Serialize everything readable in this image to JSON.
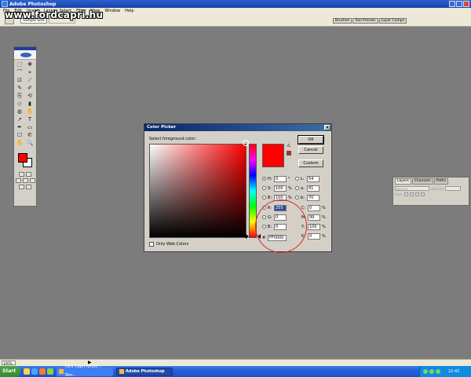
{
  "app": {
    "title": "Adobe Photoshop"
  },
  "watermark": "www.fordcapri.hu",
  "menu": [
    "File",
    "Edit",
    "Image",
    "Layer",
    "Select",
    "Filter",
    "View",
    "Window",
    "Help"
  ],
  "options": {
    "sample_size": "Sample Size:",
    "sample_value": "Point Sample"
  },
  "palette_well": [
    "Brushes",
    "Tool Presets",
    "Layer Comps"
  ],
  "toolbox": {
    "tools": [
      "⬚",
      "✥",
      "⌒",
      "⌖",
      "⊡",
      "⟋",
      "✎",
      "✐",
      "⎘",
      "⟲",
      "◇",
      "▮",
      "◍",
      "✋",
      "➚",
      "T",
      "✒",
      "▭",
      "☐",
      "✆",
      "✋",
      "🔍"
    ],
    "foreground_color": "#ff0000",
    "background_color": "#ffffff"
  },
  "layers_palette": {
    "tabs": [
      "Layers",
      "Channels",
      "Paths"
    ],
    "blend_mode": "Normal",
    "opacity_label": "Opacity:",
    "lock_label": "Lock:"
  },
  "color_picker": {
    "title": "Color Picker",
    "close": "×",
    "label": "Select foreground color:",
    "buttons": {
      "ok": "OK",
      "cancel": "Cancel",
      "custom": "Custom"
    },
    "only_web_colors": "Only Web Colors",
    "gamut_warning": "⚠",
    "current_color": "#ff0000",
    "hsb": [
      {
        "label": "H:",
        "value": "0",
        "unit": "°",
        "selected": true
      },
      {
        "label": "S:",
        "value": "100",
        "unit": "%",
        "selected": false
      },
      {
        "label": "B:",
        "value": "100",
        "unit": "%",
        "selected": false
      }
    ],
    "rgb": [
      {
        "label": "R:",
        "value": "255"
      },
      {
        "label": "G:",
        "value": "0"
      },
      {
        "label": "B:",
        "value": "0"
      }
    ],
    "lab": [
      {
        "label": "L:",
        "value": "54"
      },
      {
        "label": "a:",
        "value": "81"
      },
      {
        "label": "b:",
        "value": "70"
      }
    ],
    "cmyk": [
      {
        "label": "C:",
        "value": "0",
        "unit": "%"
      },
      {
        "label": "M:",
        "value": "99",
        "unit": "%"
      },
      {
        "label": "Y:",
        "value": "100",
        "unit": "%"
      },
      {
        "label": "K:",
        "value": "0",
        "unit": "%"
      }
    ],
    "hex_label": "#",
    "hex_value": "FF0000"
  },
  "statusbar": {
    "zoom": "100%"
  },
  "taskbar": {
    "start": "Start",
    "tasks": [
      {
        "label": "Ford Capri fórum :: Tém...",
        "active": false
      },
      {
        "label": "Adobe Photoshop",
        "active": true
      }
    ],
    "clock": "22:42"
  }
}
